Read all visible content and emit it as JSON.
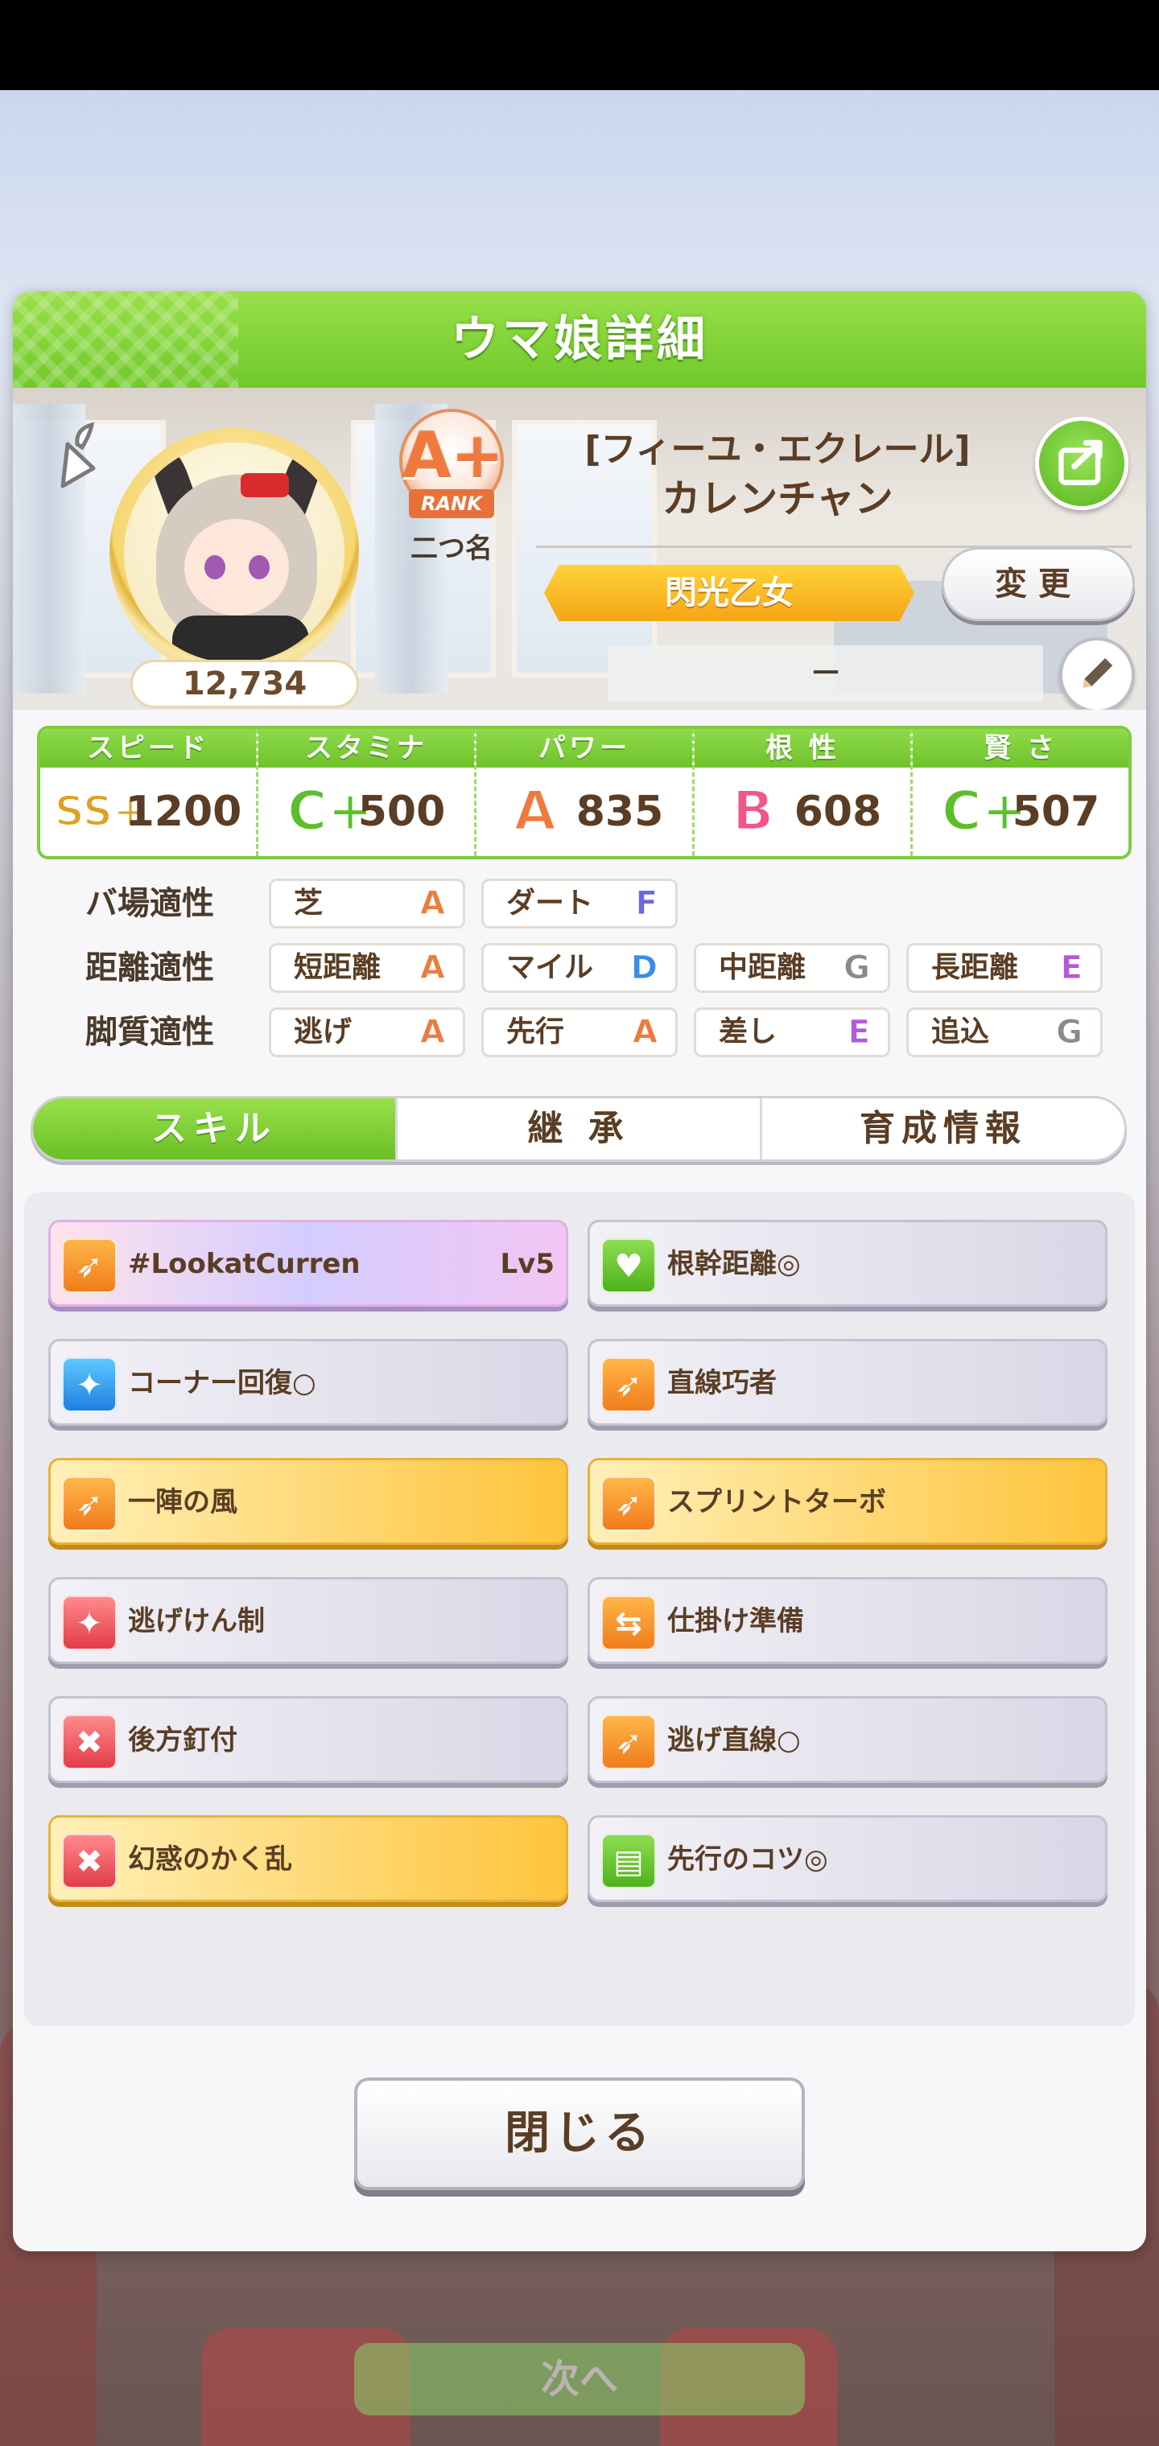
{
  "modal": {
    "title": "ウマ娘詳細"
  },
  "profile": {
    "fan_count": "12,734",
    "rank": {
      "letter": "A+",
      "label": "RANK"
    },
    "nickname_label": "二つ名",
    "title": "[フィーユ・エクレール]",
    "name": "カレンチャン",
    "nickname": "閃光乙女",
    "change_label": "変更",
    "memo": "－"
  },
  "stats": [
    {
      "label": "スピード",
      "grade": "SS+",
      "value": "1200",
      "grade_color": "#e0a020"
    },
    {
      "label": "スタミナ",
      "grade": "C+",
      "value": "500",
      "grade_color": "#5cbf2a"
    },
    {
      "label": "パワー",
      "grade": "A",
      "value": "835",
      "grade_color": "#f07a3e"
    },
    {
      "label": "根 性",
      "grade": "B",
      "value": "608",
      "grade_color": "#f0568a"
    },
    {
      "label": "賢 さ",
      "grade": "C+",
      "value": "507",
      "grade_color": "#5cbf2a"
    }
  ],
  "aptitude": {
    "track": {
      "label": "バ場適性",
      "items": [
        {
          "name": "芝",
          "grade": "A"
        },
        {
          "name": "ダート",
          "grade": "F"
        }
      ]
    },
    "distance": {
      "label": "距離適性",
      "items": [
        {
          "name": "短距離",
          "grade": "A"
        },
        {
          "name": "マイル",
          "grade": "D"
        },
        {
          "name": "中距離",
          "grade": "G"
        },
        {
          "name": "長距離",
          "grade": "E"
        }
      ]
    },
    "style": {
      "label": "脚質適性",
      "items": [
        {
          "name": "逃げ",
          "grade": "A"
        },
        {
          "name": "先行",
          "grade": "A"
        },
        {
          "name": "差し",
          "grade": "E"
        },
        {
          "name": "追込",
          "grade": "G"
        }
      ]
    }
  },
  "grade_colors": {
    "A": "#f07a3e",
    "B": "#f0568a",
    "C": "#5cbf2a",
    "D": "#3a8ee8",
    "E": "#b15ad8",
    "F": "#6a6adf",
    "G": "#8a8a8a"
  },
  "tabs": [
    "スキル",
    "継 承",
    "育成情報"
  ],
  "skills": [
    {
      "name": "#LookatCurren",
      "level": "Lv5",
      "style": "unique",
      "icon": "running-icon",
      "icon_color": "orange"
    },
    {
      "name": "根幹距離◎",
      "style": "normal",
      "icon": "heart-icon",
      "icon_color": "green"
    },
    {
      "name": "コーナー回復○",
      "style": "normal",
      "icon": "sparkle-icon",
      "icon_color": "blue"
    },
    {
      "name": "直線巧者",
      "style": "normal",
      "icon": "running-icon",
      "icon_color": "orange"
    },
    {
      "name": "一陣の風",
      "style": "gold",
      "icon": "running-icon",
      "icon_color": "orange"
    },
    {
      "name": "スプリントターボ",
      "style": "gold",
      "icon": "running-icon",
      "icon_color": "orange"
    },
    {
      "name": "逃げけん制",
      "style": "normal",
      "icon": "sparkle-icon",
      "icon_color": "red"
    },
    {
      "name": "仕掛け準備",
      "style": "normal",
      "icon": "arrow-icon",
      "icon_color": "orange"
    },
    {
      "name": "後方釘付",
      "style": "normal",
      "icon": "debuff-icon",
      "icon_color": "red"
    },
    {
      "name": "逃げ直線○",
      "style": "normal",
      "icon": "running-icon",
      "icon_color": "orange"
    },
    {
      "name": "幻惑のかく乱",
      "style": "gold",
      "icon": "debuff-icon",
      "icon_color": "red"
    },
    {
      "name": "先行のコツ◎",
      "style": "normal",
      "icon": "book-icon",
      "icon_color": "green"
    }
  ],
  "close_label": "閉じる",
  "background_next_label": "次へ"
}
